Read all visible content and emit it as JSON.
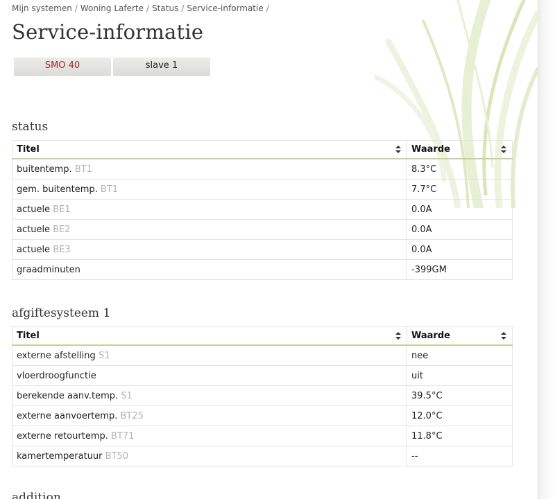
{
  "breadcrumb": [
    {
      "label": "Mijn systemen"
    },
    {
      "label": "Woning Laferte"
    },
    {
      "label": "Status"
    },
    {
      "label": "Service-informatie"
    }
  ],
  "breadcrumb_separator": "/",
  "page_title": "Service-informatie",
  "tabs": [
    {
      "label": "SMO 40",
      "active": true
    },
    {
      "label": "slave 1",
      "active": false
    }
  ],
  "colors": {
    "active_tab_text": "#9c2a2a",
    "header_underline": "#c9cf9a",
    "code_gray": "#b3b3b3"
  },
  "sections": [
    {
      "title": "status",
      "columns": [
        "Titel",
        "Waarde"
      ],
      "rows": [
        {
          "label": "buitentemp.",
          "code": "BT1",
          "value": "8.3°C"
        },
        {
          "label": "gem. buitentemp.",
          "code": "BT1",
          "value": "7.7°C"
        },
        {
          "label": "actuele",
          "code": "BE1",
          "value": "0.0A"
        },
        {
          "label": "actuele",
          "code": "BE2",
          "value": "0.0A"
        },
        {
          "label": "actuele",
          "code": "BE3",
          "value": "0.0A"
        },
        {
          "label": "graadminuten",
          "code": "",
          "value": "-399GM"
        }
      ]
    },
    {
      "title": "afgiftesysteem 1",
      "columns": [
        "Titel",
        "Waarde"
      ],
      "rows": [
        {
          "label": "externe afstelling",
          "code": "S1",
          "value": "nee"
        },
        {
          "label": "vloerdroogfunctie",
          "code": "",
          "value": "uit"
        },
        {
          "label": "berekende aanv.temp.",
          "code": "S1",
          "value": "39.5°C"
        },
        {
          "label": "externe aanvoertemp.",
          "code": "BT25",
          "value": "12.0°C"
        },
        {
          "label": "externe retourtemp.",
          "code": "BT71",
          "value": "11.8°C"
        },
        {
          "label": "kamertemperatuur",
          "code": "BT50",
          "value": "--"
        }
      ]
    }
  ],
  "cut_off_section_title": "addition",
  "icons": {
    "sort": "sort-up-down-icon",
    "decoration": "grass-background"
  }
}
